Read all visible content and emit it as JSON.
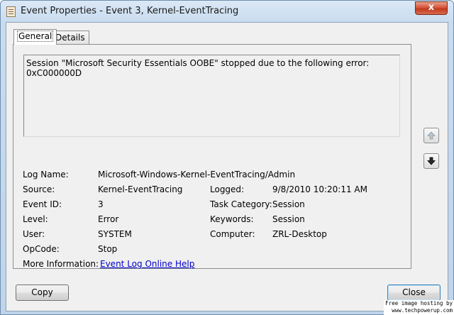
{
  "window": {
    "title": "Event Properties - Event 3, Kernel-EventTracing",
    "close_glyph": "x"
  },
  "tabs": [
    {
      "label": "General"
    },
    {
      "label": "Details"
    }
  ],
  "description": "Session \"Microsoft Security Essentials OOBE\" stopped due to the following error: 0xC000000D",
  "fields": {
    "log_name": {
      "label": "Log Name:",
      "value": "Microsoft-Windows-Kernel-EventTracing/Admin"
    },
    "source": {
      "label": "Source:",
      "value": "Kernel-EventTracing"
    },
    "logged": {
      "label": "Logged:",
      "value": "9/8/2010 10:20:11 AM"
    },
    "event_id": {
      "label": "Event ID:",
      "value": "3"
    },
    "task_category": {
      "label": "Task Category:",
      "value": "Session"
    },
    "level": {
      "label": "Level:",
      "value": "Error"
    },
    "keywords": {
      "label": "Keywords:",
      "value": "Session"
    },
    "user": {
      "label": "User:",
      "value": "SYSTEM"
    },
    "computer": {
      "label": "Computer:",
      "value": "ZRL-Desktop"
    },
    "opcode": {
      "label": "OpCode:",
      "value": "Stop"
    },
    "more_info": {
      "label": "More Information:",
      "value": "Event Log Online Help"
    }
  },
  "buttons": {
    "copy": "Copy",
    "close": "Close"
  },
  "watermark": {
    "line1": "Free image hosting by",
    "line2": "www.techpowerup.com"
  }
}
